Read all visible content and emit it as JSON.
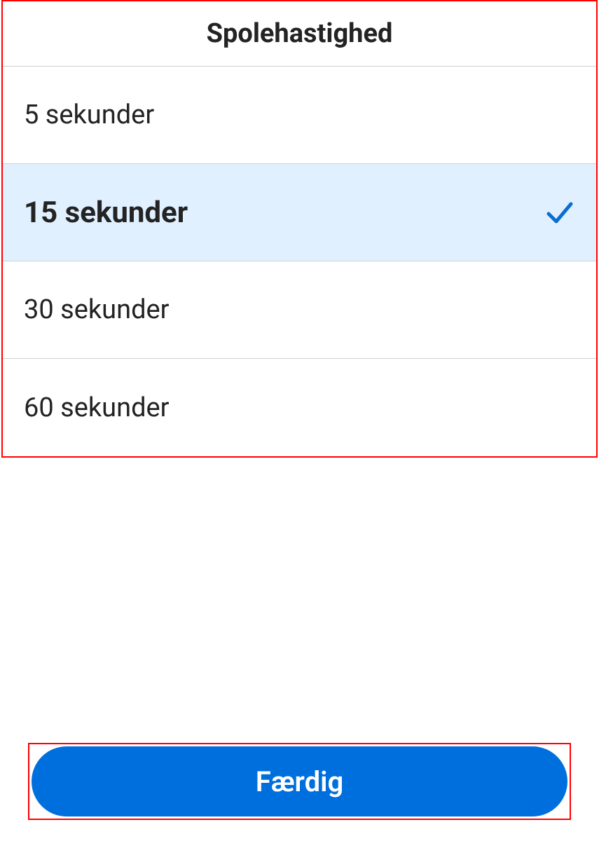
{
  "dialog": {
    "title": "Spolehastighed",
    "options": [
      {
        "label": "5 sekunder",
        "selected": false
      },
      {
        "label": "15 sekunder",
        "selected": true
      },
      {
        "label": "30 sekunder",
        "selected": false
      },
      {
        "label": "60 sekunder",
        "selected": false
      }
    ],
    "done_button": "Færdig"
  }
}
